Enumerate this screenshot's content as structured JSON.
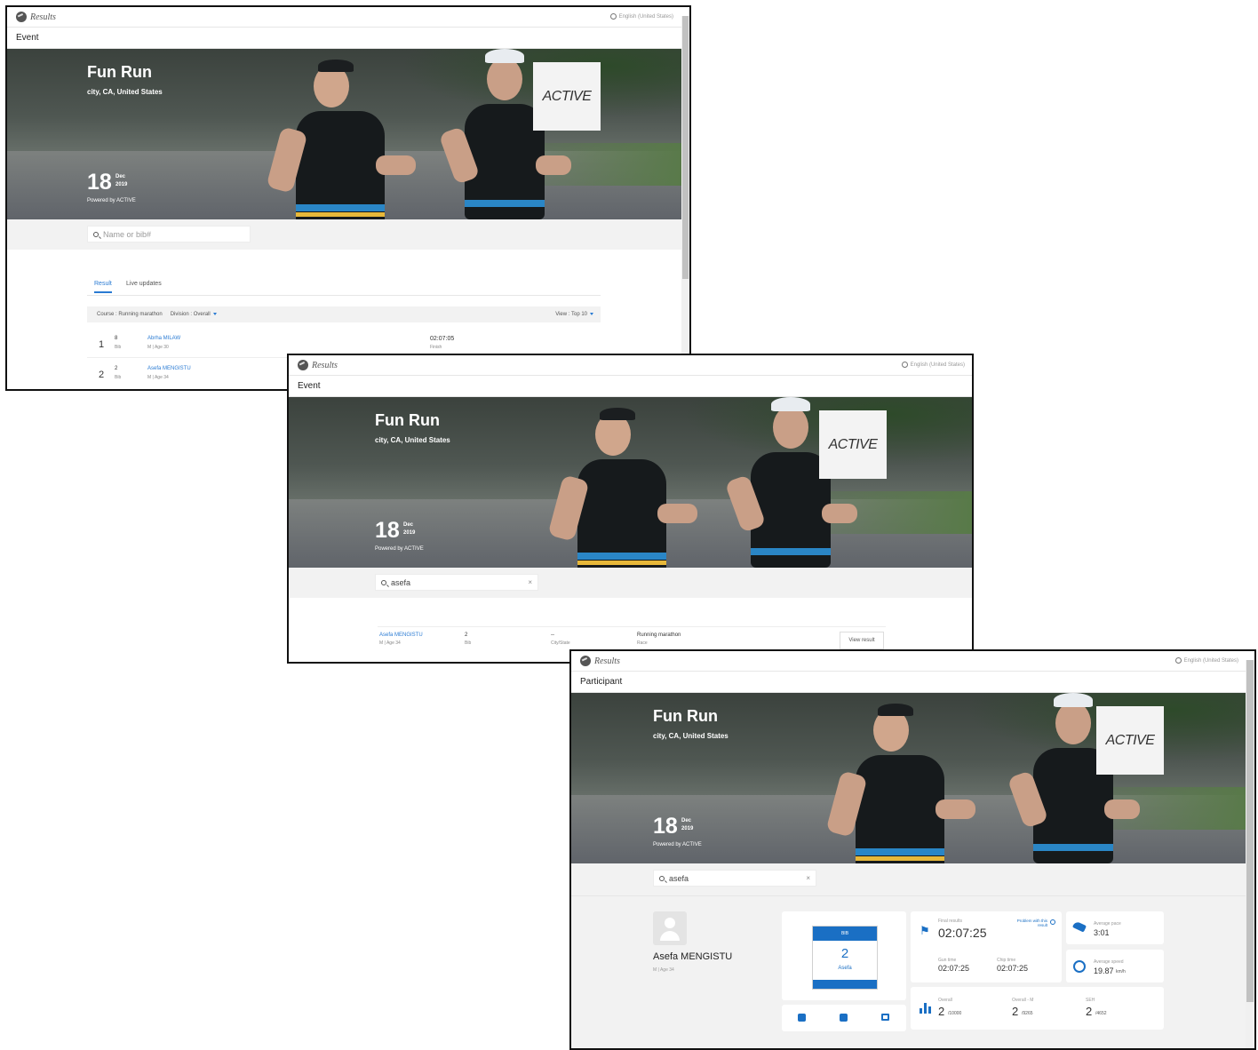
{
  "common": {
    "app_name": "Results",
    "app_trademark": "®",
    "language": "English (United States)",
    "event_title": "Fun Run",
    "event_location": "city, CA, United States",
    "date_day": "18",
    "date_month": "Dec",
    "date_year": "2019",
    "powered_by": "Powered by ACTIVE",
    "sponsor_logo_text": "ACTIVE"
  },
  "window1": {
    "breadcrumb": "Event",
    "search_placeholder": "Name or bib#",
    "tabs": [
      {
        "label": "Result",
        "active": true
      },
      {
        "label": "Live updates",
        "active": false
      }
    ],
    "course_filter": "Course : Running marathon",
    "division_filter": "Division : Overall",
    "view_filter": "View : Top 10",
    "results": [
      {
        "rank": "1",
        "bib": "8",
        "bib_label": "Bib",
        "name": "Abrha MILAW",
        "meta": "M | Age 30",
        "time": "02:07:05",
        "status": "Finish"
      },
      {
        "rank": "2",
        "bib": "2",
        "bib_label": "Bib",
        "name": "Asefa MENGISTU",
        "meta": "M | Age 34",
        "time": "",
        "status": ""
      }
    ]
  },
  "window2": {
    "breadcrumb": "Event",
    "search_value": "asefa",
    "clear_icon": "×",
    "search_result": {
      "name": "Asefa MENGISTU",
      "meta": "M | Age 34",
      "bib": "2",
      "bib_label": "Bib",
      "city": "--",
      "city_label": "City/State",
      "race": "Running marathon",
      "race_label": "Race",
      "button": "View result"
    }
  },
  "window3": {
    "breadcrumb": "Participant",
    "search_value": "asefa",
    "clear_icon": "×",
    "participant_name": "Asefa MENGISTU",
    "participant_meta": "M | Age 34",
    "bib_card": {
      "header": "BIB",
      "number": "2",
      "name": "Asefa"
    },
    "final_results_label": "Final results",
    "final_time": "02:07:25",
    "problem_link": "Problem with this result",
    "gun_time_label": "Gun time",
    "gun_time": "02:07:25",
    "chip_time_label": "Chip time",
    "chip_time": "02:07:25",
    "avg_pace_label": "Average pace",
    "avg_pace": "3:01",
    "avg_speed_label": "Average speed",
    "avg_speed": "19.87",
    "avg_speed_unit": "km/h",
    "rank_overall_label": "Overall",
    "rank_overall": "2",
    "rank_overall_total": "/10000",
    "rank_overall_m_label": "Overall - M",
    "rank_overall_m": "2",
    "rank_overall_m_total": "/9265",
    "rank_sex_label": "SEH",
    "rank_sex": "2",
    "rank_sex_total": "/4652"
  },
  "colors": {
    "link_blue": "#2a7bd3",
    "bib_blue": "#1a6fc4",
    "dark_text": "#222222"
  }
}
